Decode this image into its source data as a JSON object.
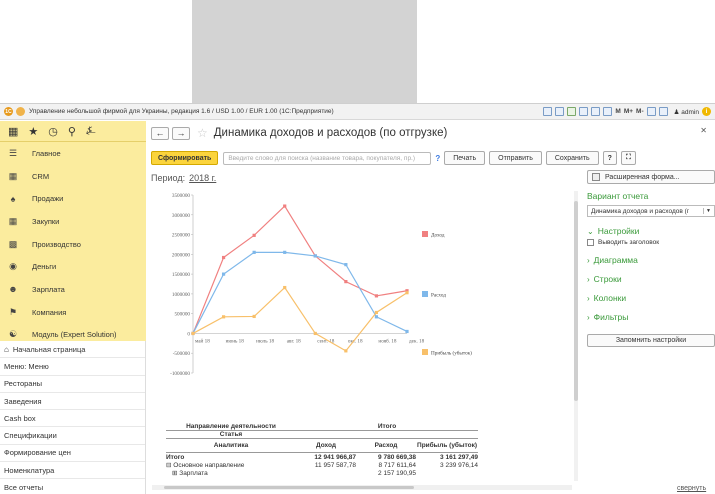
{
  "window": {
    "title": "Управление небольшой фирмой для Украины, редакция 1.6 / USD 1.00 / EUR 1.00  (1С:Предприятие)",
    "toolbar_labels": [
      "M",
      "M+",
      "M-"
    ],
    "user": "admin"
  },
  "sidebar": {
    "items": [
      {
        "icon": "hamburger-icon",
        "label": "Главное"
      },
      {
        "icon": "crm-icon",
        "label": "CRM"
      },
      {
        "icon": "sales-icon",
        "label": "Продажи"
      },
      {
        "icon": "purchases-icon",
        "label": "Закупки"
      },
      {
        "icon": "production-icon",
        "label": "Производство"
      },
      {
        "icon": "money-icon",
        "label": "Деньги"
      },
      {
        "icon": "salary-icon",
        "label": "Зарплата"
      },
      {
        "icon": "company-icon",
        "label": "Компания"
      },
      {
        "icon": "module-icon",
        "label": "Модуль (Expert Solution)"
      }
    ],
    "bottom": [
      "Начальная страница",
      "Меню: Меню",
      "Рестораны",
      "Заведения",
      "Cash box",
      "Спецификации",
      "Формирование цен",
      "Номенклатура",
      "Все отчеты"
    ]
  },
  "report": {
    "title": "Динамика доходов и расходов (по отгрузке)",
    "generate_btn": "Сформировать",
    "search_placeholder": "Введите слово для поиска (название товара, покупателя, пр.)",
    "print_btn": "Печать",
    "send_btn": "Отправить",
    "save_btn": "Сохранить",
    "help_btn": "?",
    "period_label": "Период:",
    "period_value": "2018 г."
  },
  "chart_data": {
    "type": "line",
    "categories": [
      "май 18",
      "июнь 18",
      "июль 18",
      "авг. 18",
      "сент. 18",
      "окт. 18",
      "нояб. 18",
      "дек. 18"
    ],
    "yticks": [
      "3500000",
      "3000000",
      "2500000",
      "2000000",
      "1500000",
      "1000000",
      "500000",
      "0",
      "-500000",
      "-1000000"
    ],
    "ylim": [
      -1000000,
      3500000
    ],
    "series": [
      {
        "name": "Доход",
        "color": "#f08080",
        "values": [
          0,
          1920000,
          2480000,
          3220000,
          1960000,
          1310000,
          950000,
          1080000
        ]
      },
      {
        "name": "Расход",
        "color": "#7fb8ea",
        "values": [
          0,
          1500000,
          2050000,
          2050000,
          1960000,
          1740000,
          420000,
          50000
        ]
      },
      {
        "name": "Прибыль (убыток)",
        "color": "#f8c06a",
        "values": [
          0,
          420000,
          430000,
          1160000,
          0,
          -440000,
          530000,
          1030000
        ]
      }
    ]
  },
  "table": {
    "group_header": "Направление деятельности",
    "sub_header": "Статья",
    "col_group": "Итого",
    "col_analytics": "Аналитика",
    "cols": [
      "Доход",
      "Расход",
      "Прибыль (убыток)"
    ],
    "rows": [
      {
        "label": "Итого",
        "values": [
          "12 941 966,87",
          "9 780 669,38",
          "3 161 297,49"
        ]
      },
      {
        "label": "Основное направление",
        "values": [
          "11 957 587,78",
          "8 717 611,64",
          "3 239 976,14"
        ]
      },
      {
        "label": "Зарплата",
        "values": [
          "",
          "2 157 190,95",
          ""
        ]
      }
    ]
  },
  "right_panel": {
    "advanced_btn": "Расширенная форма...",
    "variant_title": "Вариант отчета",
    "variant_value": "Динамика доходов и расходов (г",
    "sections": [
      "Настройки",
      "Диаграмма",
      "Строки",
      "Колонки",
      "Фильтры"
    ],
    "checkbox_label": "Выводить заголовок",
    "remember_btn": "Запомнить настройки",
    "collapse_link": "свернуть"
  }
}
